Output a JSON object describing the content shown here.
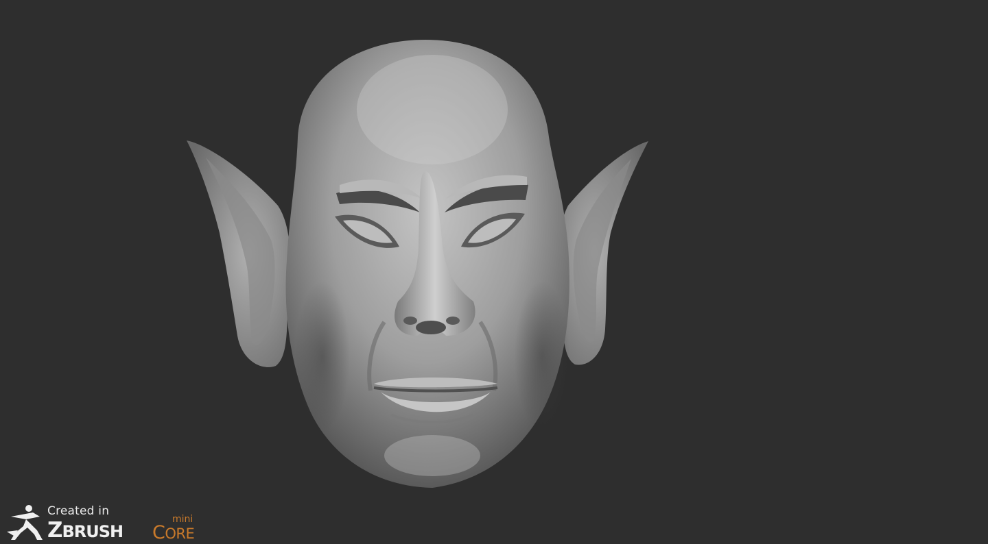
{
  "watermark": {
    "created_in": "Created in",
    "brand_z": "Z",
    "brand_rest": "BRUSH",
    "core_c": "C",
    "core_rest": "ORE",
    "mini": "mini",
    "logo_icon": "zbrush-figure-icon",
    "accent_color": "#c97a2b"
  },
  "scene": {
    "subject_icon": "elf-head-sculpt",
    "background_color": "#2e2e2e",
    "clay_color": "#a9a9a9"
  }
}
